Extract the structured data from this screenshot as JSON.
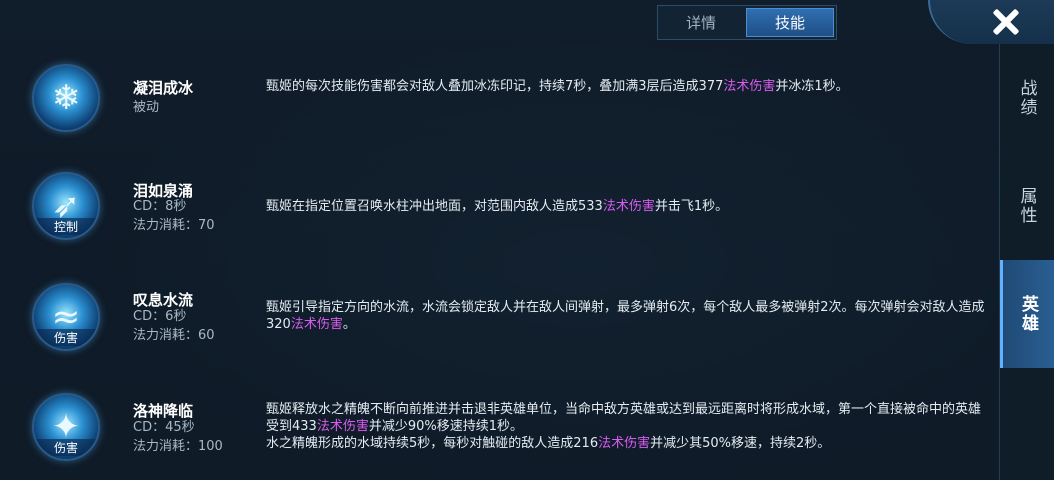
{
  "tabs": [
    {
      "label": "详情",
      "active": false
    },
    {
      "label": "技能",
      "active": true
    }
  ],
  "sidenav": [
    {
      "label": "战绩",
      "active": false
    },
    {
      "label": "属性",
      "active": false
    },
    {
      "label": "英雄",
      "active": true
    }
  ],
  "skills": [
    {
      "name": "凝泪成冰",
      "type": "被动",
      "icon": "snowflake-icon",
      "desc_a": "甄姬的每次技能伤害都会对敌人叠加冰冻印记，持续7秒，叠加满3层后造成377",
      "desc_magic": "法术伤害",
      "desc_b": "并冰冻1秒。"
    },
    {
      "name": "泪如泉涌",
      "cd": "CD：8秒",
      "cost": "法力消耗：70",
      "tag": "控制",
      "icon": "water-burst-icon",
      "desc_a": "甄姬在指定位置召唤水柱冲出地面，对范围内敌人造成533",
      "desc_magic": "法术伤害",
      "desc_b": "并击飞1秒。"
    },
    {
      "name": "叹息水流",
      "cd": "CD：6秒",
      "cost": "法力消耗：60",
      "tag": "伤害",
      "icon": "water-stream-icon",
      "desc_a": "甄姬引导指定方向的水流，水流会锁定敌人并在敌人间弹射，最多弹射6次，每个敌人最多被弹射2次。每次弹射会对敌人造成320",
      "desc_magic": "法术伤害",
      "desc_b": "。"
    },
    {
      "name": "洛神降临",
      "cd": "CD：45秒",
      "cost": "法力消耗：100",
      "tag": "伤害",
      "icon": "water-spirit-icon",
      "desc_a": "甄姬释放水之精魄不断向前推进并击退非英雄单位，当命中敌方英雄或达到最远距离时将形成水域，第一个直接被命中的英雄受到433",
      "desc_magic": "法术伤害",
      "desc_b": "并减少90%移速持续1秒。",
      "desc_c": "水之精魄形成的水域持续5秒，每秒对触碰的敌人造成216",
      "desc_magic2": "法术伤害",
      "desc_d": "并减少其50%移速，持续2秒。"
    }
  ]
}
